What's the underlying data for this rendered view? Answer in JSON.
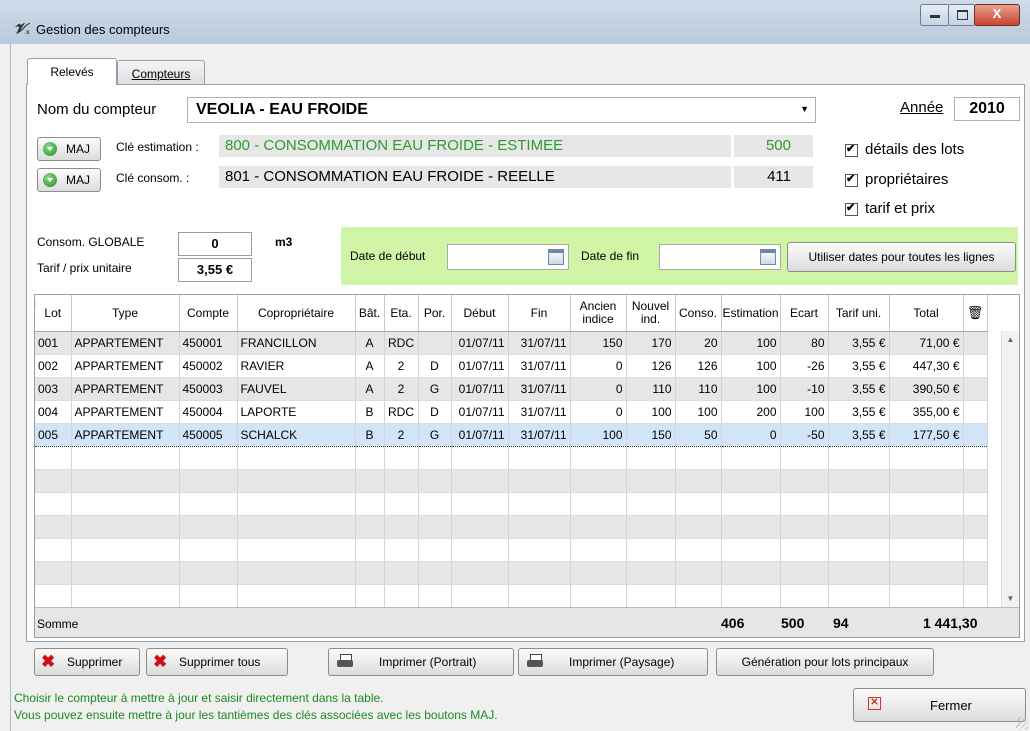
{
  "window": {
    "title": "Gestion des compteurs",
    "min_icon": "minimize-icon",
    "max_icon": "maximize-icon",
    "close_label": "X"
  },
  "tabs": [
    {
      "label": "Relevés"
    },
    {
      "label": "Compteurs"
    }
  ],
  "compteur": {
    "label": "Nom du compteur",
    "value": "VEOLIA - EAU FROIDE"
  },
  "annee": {
    "label": "Année",
    "value": "2010"
  },
  "cle_estimation": {
    "button": "MAJ",
    "label": "Clé estimation :",
    "value": "800 - CONSOMMATION EAU FROIDE - ESTIMEE",
    "amount": "500"
  },
  "cle_consom": {
    "button": "MAJ",
    "label": "Clé consom. :",
    "value": "801 - CONSOMMATION EAU FROIDE - REELLE",
    "amount": "411"
  },
  "options": [
    {
      "label": "détails des lots",
      "checked": true
    },
    {
      "label": "propriétaires",
      "checked": true
    },
    {
      "label": "tarif et prix",
      "checked": true
    }
  ],
  "consom_globale": {
    "label": "Consom. GLOBALE",
    "value": "0",
    "unit": "m3"
  },
  "tarif": {
    "label": "Tarif / prix unitaire",
    "value": "3,55 €"
  },
  "dates": {
    "debut_label": "Date de début",
    "fin_label": "Date de fin",
    "debut_value": "",
    "fin_value": "",
    "button": "Utiliser dates pour toutes les lignes"
  },
  "table": {
    "columns": [
      "Lot",
      "Type",
      "Compte",
      "Copropriétaire",
      "Bât.",
      "Eta.",
      "Por.",
      "Début",
      "Fin",
      "Ancien indice",
      "Nouvel ind.",
      "Conso.",
      "Estimation",
      "Ecart",
      "Tarif uni.",
      "Total"
    ],
    "rows": [
      [
        "001",
        "APPARTEMENT",
        "450001",
        "FRANCILLON",
        "A",
        "RDC",
        "",
        "01/07/11",
        "31/07/11",
        "150",
        "170",
        "20",
        "100",
        "80",
        "3,55 €",
        "71,00 €"
      ],
      [
        "002",
        "APPARTEMENT",
        "450002",
        "RAVIER",
        "A",
        "2",
        "D",
        "01/07/11",
        "31/07/11",
        "0",
        "126",
        "126",
        "100",
        "-26",
        "3,55 €",
        "447,30 €"
      ],
      [
        "003",
        "APPARTEMENT",
        "450003",
        "FAUVEL",
        "A",
        "2",
        "G",
        "01/07/11",
        "31/07/11",
        "0",
        "110",
        "110",
        "100",
        "-10",
        "3,55 €",
        "390,50 €"
      ],
      [
        "004",
        "APPARTEMENT",
        "450004",
        "LAPORTE",
        "B",
        "RDC",
        "D",
        "01/07/11",
        "31/07/11",
        "0",
        "100",
        "100",
        "200",
        "100",
        "3,55 €",
        "355,00 €"
      ],
      [
        "005",
        "APPARTEMENT",
        "450005",
        "SCHALCK",
        "B",
        "2",
        "G",
        "01/07/11",
        "31/07/11",
        "100",
        "150",
        "50",
        "0",
        "-50",
        "3,55 €",
        "177,50 €"
      ]
    ],
    "selected_row": 4,
    "sum_label": "Somme",
    "sum_conso": "406",
    "sum_estimation": "500",
    "sum_ecart": "94",
    "sum_total": "1 441,30"
  },
  "buttons": {
    "supprimer": "Supprimer",
    "supprimer_tous": "Supprimer tous",
    "imprimer_portrait": "Imprimer (Portrait)",
    "imprimer_paysage": "Imprimer (Paysage)",
    "generation": "Génération pour lots principaux",
    "fermer": "Fermer"
  },
  "status": {
    "line1": "Choisir le compteur à mettre à jour et saisir directement dans la table.",
    "line2": "Vous pouvez ensuite mettre à jour les tantièmes des clés associées avec les boutons MAJ."
  },
  "colors": {
    "green_text": "#2e9a2e",
    "green_band": "#d0f5a7",
    "selection": "#d2e4f8"
  }
}
